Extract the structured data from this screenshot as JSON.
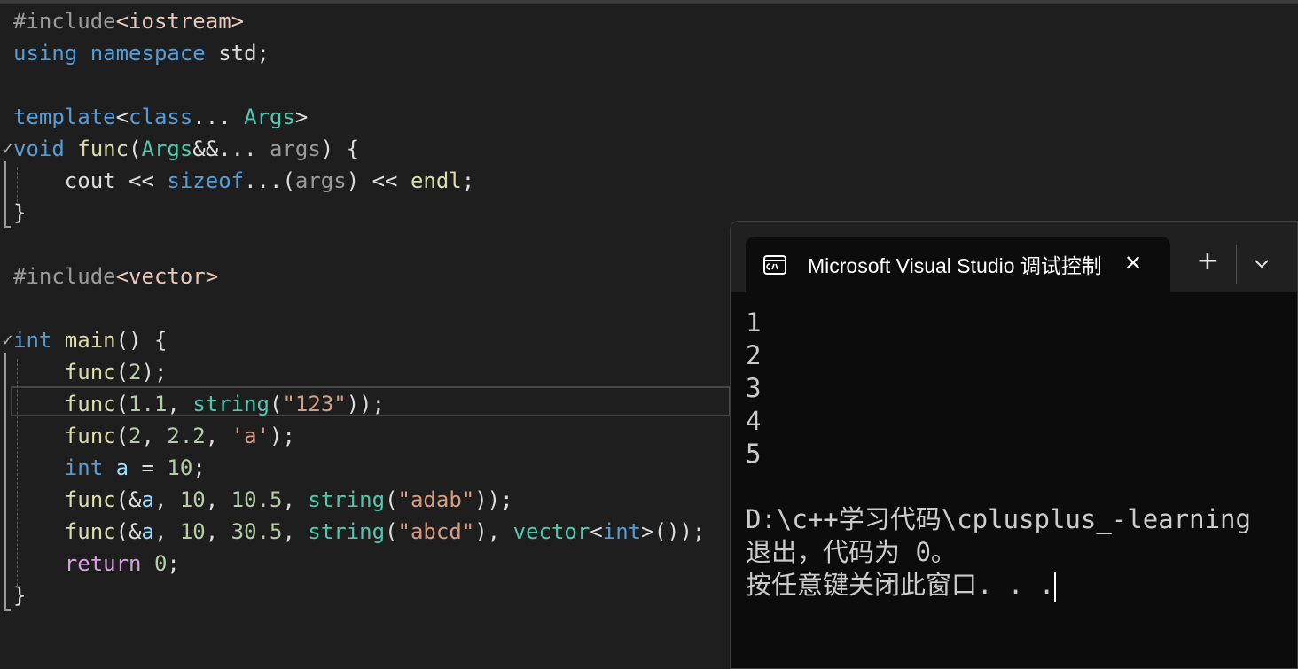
{
  "editor": {
    "line1": {
      "directive": "#include",
      "header": "<iostream>"
    },
    "line2": {
      "kw_using": "using",
      "kw_namespace": "namespace",
      "rest": " std;"
    },
    "line4": {
      "kw_template": "template",
      "lt": "<",
      "kw_class": "class",
      "dots": "... ",
      "ty_args": "Args",
      "gt": ">"
    },
    "line5": {
      "kw_void": "void",
      "fn": " func",
      "paren": "(",
      "ty_args": "Args",
      "amp": "&&",
      "dots": "... ",
      "param": "args",
      "rest": ") {"
    },
    "line6": {
      "indent": "    ",
      "cout": "cout",
      "op1": " << ",
      "kw_sizeof": "sizeof",
      "dots": "...",
      "lparen": "(",
      "param": "args",
      "rparen": ")",
      "op2": " << ",
      "endl": "endl",
      "semi": ";"
    },
    "line7": {
      "brace": "}"
    },
    "line9": {
      "directive": "#include",
      "header": "<vector>"
    },
    "line11": {
      "kw_int": "int",
      "fn": " main",
      "rest": "() {"
    },
    "line12": {
      "indent": "    ",
      "fn": "func",
      "open": "(",
      "n1": "2",
      "close": ");"
    },
    "line13": {
      "indent": "    ",
      "fn": "func",
      "open": "(",
      "n1": "1.1",
      "sep1": ", ",
      "ty_string": "string",
      "p1": "(",
      "s1": "\"123\"",
      "close": "));"
    },
    "line14": {
      "indent": "    ",
      "fn": "func",
      "open": "(",
      "n1": "2",
      "sep1": ", ",
      "n2": "2.2",
      "sep2": ", ",
      "s1": "'a'",
      "close": ");"
    },
    "line15": {
      "indent": "    ",
      "kw_int": "int",
      "sp": " ",
      "var": "a",
      "eq": " = ",
      "n1": "10",
      "semi": ";"
    },
    "line16": {
      "indent": "    ",
      "fn": "func",
      "open": "(&",
      "var": "a",
      "sep1": ", ",
      "n1": "10",
      "sep2": ", ",
      "n2": "10.5",
      "sep3": ", ",
      "ty_string": "string",
      "p1": "(",
      "s1": "\"adab\"",
      "close": "));"
    },
    "line17": {
      "indent": "    ",
      "fn": "func",
      "open": "(&",
      "var": "a",
      "sep1": ", ",
      "n1": "10",
      "sep2": ", ",
      "n2": "30.5",
      "sep3": ", ",
      "ty_string": "string",
      "p1": "(",
      "s1": "\"abcd\"",
      "sep4": "), ",
      "ty_vector": "vector",
      "lt": "<",
      "kw_int": "int",
      "gt": ">",
      "close": "());"
    },
    "line18": {
      "indent": "    ",
      "kw_return": "return",
      "sp": " ",
      "n1": "0",
      "semi": ";"
    },
    "line19": {
      "brace": "}"
    },
    "fold_glyph": "✓"
  },
  "terminal": {
    "tab_title": "Microsoft Visual Studio 调试控制台",
    "close_glyph": "✕",
    "new_tab_glyph": "+",
    "output": [
      "1",
      "2",
      "3",
      "4",
      "5",
      "",
      "D:\\c++学习代码\\cplusplus_-learning",
      "退出，代码为 0。",
      "按任意键关闭此窗口. . ."
    ]
  },
  "icons": {
    "tab_icon": "terminal-icon",
    "dropdown_icon": "chevron-down-icon"
  },
  "colors": {
    "editor_bg": "#1e1e1e",
    "terminal_bg": "#0c0c0c",
    "keyword": "#569cd6",
    "type": "#4ec9b0",
    "function": "#dcdcaa",
    "string": "#d69d85",
    "number": "#b5cea8"
  }
}
